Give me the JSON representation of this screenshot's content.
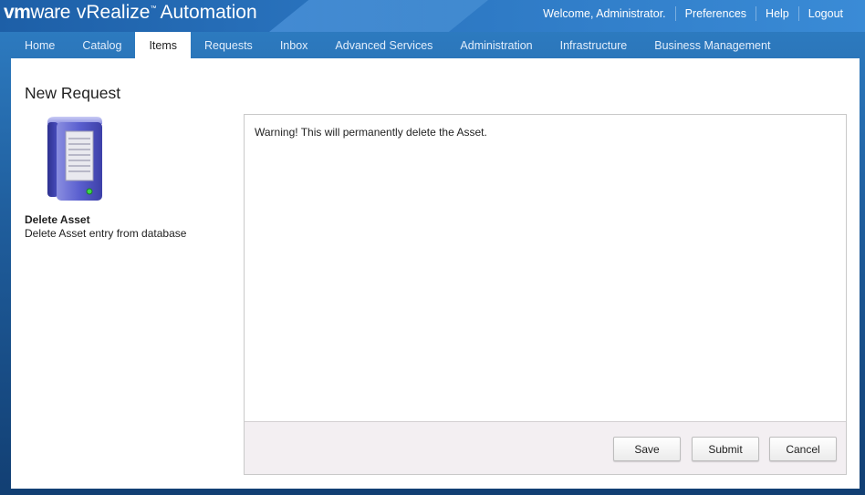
{
  "header": {
    "logo_vm": "vm",
    "logo_ware": "ware",
    "product": "vRealize",
    "product_tm": "™",
    "product_suffix": "Automation",
    "welcome": "Welcome, Administrator.",
    "preferences": "Preferences",
    "help": "Help",
    "logout": "Logout"
  },
  "tabs": [
    {
      "label": "Home"
    },
    {
      "label": "Catalog"
    },
    {
      "label": "Items",
      "active": true
    },
    {
      "label": "Requests"
    },
    {
      "label": "Inbox"
    },
    {
      "label": "Advanced Services"
    },
    {
      "label": "Administration"
    },
    {
      "label": "Infrastructure"
    },
    {
      "label": "Business Management"
    }
  ],
  "page": {
    "title": "New Request",
    "item_icon": "server-icon",
    "item_name": "Delete Asset",
    "item_description": "Delete Asset entry from database"
  },
  "form": {
    "warning": "Warning! This will permanently delete the Asset.",
    "save_label": "Save",
    "submit_label": "Submit",
    "cancel_label": "Cancel"
  },
  "colors": {
    "header_blue": "#2a74bf",
    "background_blue": "#1f5d9c",
    "footer_bar": "#f3eff2"
  }
}
